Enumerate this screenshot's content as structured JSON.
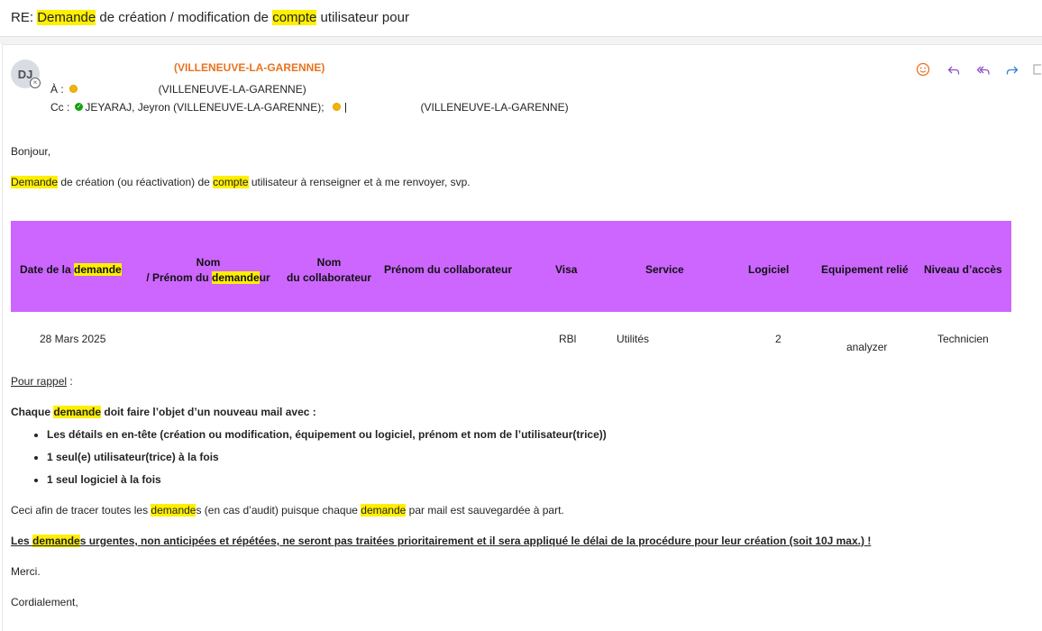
{
  "subject": {
    "prefix": "RE: ",
    "w1": "Demande",
    "mid": " de création / modification de ",
    "w2": "compte",
    "suffix": " utilisateur pour"
  },
  "header": {
    "avatar_initials": "DJ",
    "sender": "(VILLENEUVE-LA-GARENNE)",
    "to_label": "À :",
    "to_value": "(VILLENEUVE-LA-GARENNE)",
    "cc_label": "Cc :",
    "cc_first": "JEYARAJ, Jeyron (VILLENEUVE-LA-GARENNE);",
    "cc_second": "(VILLENEUVE-LA-GARENNE)",
    "icons": [
      "emoji-icon",
      "reply-icon",
      "reply-all-icon",
      "forward-icon"
    ],
    "accent_color": "#e8731e"
  },
  "body": {
    "greeting": "Bonjour,",
    "intro": {
      "w1": "Demande",
      "mid": " de création (ou réactivation) de ",
      "w2": "compte",
      "suffix": " utilisateur à renseigner et à me renvoyer, svp."
    },
    "table": {
      "header_color": "#cc66ff",
      "headers": {
        "date_a": "Date de la ",
        "date_b": "demande",
        "nom1_line1": "Nom",
        "nom1_line2a": "/ Prénom du ",
        "nom1_line2b": "demande",
        "nom1_line2c": "ur",
        "nom2_line1": "Nom",
        "nom2_line2": "du collaborateur",
        "prenom": "Prénom du collaborateur",
        "visa": "Visa",
        "service": "Service",
        "logiciel": "Logiciel",
        "equipement": "Equipement relié",
        "niveau": "Niveau d’accès"
      },
      "row": {
        "date": "28 Mars 2025",
        "visa": "RBl",
        "service": "Utilités",
        "logiciel": "2",
        "equipement": "analyzer",
        "niveau": "Technicien"
      }
    },
    "rappel": "Pour rappel",
    "rappel_colon": " :",
    "chaque": {
      "a": "Chaque ",
      "b": "demande",
      "c": " doit faire l’objet d’un nouveau mail avec :"
    },
    "rules": [
      "Les détails en en-tête (création ou modification, équipement ou logiciel, prénom et nom de l’utilisateur(trice))",
      "1 seul(e) utilisateur(trice) à la fois",
      "1 seul logiciel à la fois"
    ],
    "ceci": {
      "a": "Ceci afin de tracer toutes les ",
      "b": "demande",
      "c": "s (en cas d’audit) puisque chaque ",
      "d": "demande",
      "e": " par mail est sauvegardée à part."
    },
    "urgent": {
      "a": "Les ",
      "b": "demande",
      "c": "s urgentes, non anticipées et répétées, ne seront pas traitées prioritairement et il sera appliqué le délai de la procédure pour leur création (soit 10J max.) !"
    },
    "merci": "Merci.",
    "closing": "Cordialement,"
  }
}
